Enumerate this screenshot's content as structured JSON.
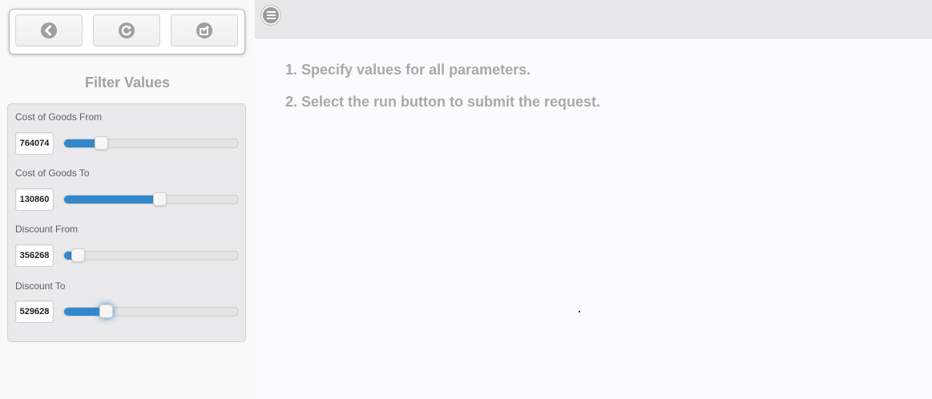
{
  "toolbar": {
    "buttons": [
      {
        "icon": "back-icon"
      },
      {
        "icon": "refresh-icon"
      },
      {
        "icon": "share-icon"
      }
    ]
  },
  "filter": {
    "title": "Filter Values",
    "params": [
      {
        "label": "Cost of Goods From",
        "value": "764074",
        "slider_fraction": 0.21
      },
      {
        "label": "Cost of Goods To",
        "value": "130860",
        "slider_fraction": 0.55
      },
      {
        "label": "Discount From",
        "value": "356268",
        "slider_fraction": 0.08
      },
      {
        "label": "Discount To",
        "value": "529628",
        "slider_fraction": 0.24
      }
    ]
  },
  "header": {
    "menu_icon": "hamburger-menu-icon"
  },
  "instructions": [
    "1. Specify values for all parameters.",
    "2. Select the run button to submit the request."
  ],
  "colors": {
    "accent": "#3388cc",
    "title_text": "#a2a2a2",
    "instruction_text": "#a9a9a9"
  }
}
